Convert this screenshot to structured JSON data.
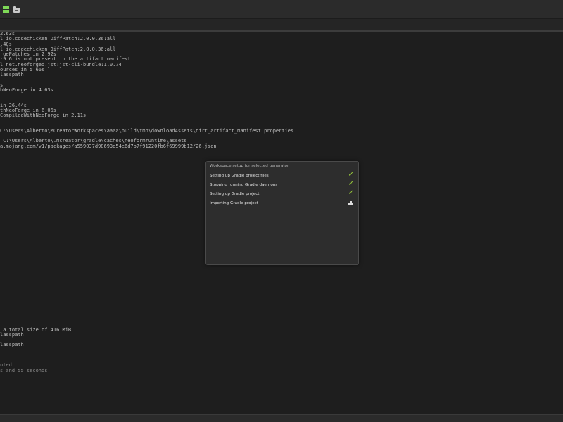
{
  "console": {
    "lines": [
      "2.63s",
      "l io.codechicken:DiffPatch:2.0.0.36:all",
      ".40s",
      "l io.codechicken:DiffPatch:2.0.0.36:all",
      "rgePatches in 2.92s",
      ":9.6 is not present in the artifact manifest",
      "l net.neoforged.jst:jst-cli-bundle:1.0.74",
      "ources in 5.66s",
      "lasspath",
      "",
      "s",
      "hNeoForge in 4.63s",
      "",
      "",
      "in 26.44s",
      "thNeoForge in 6.06s",
      "CompiledWithNeoForge in 2.11s",
      "",
      "",
      "C:\\Users\\Alberto\\MCreatorWorkspaces\\aaaa\\build\\tmp\\downloadAssets\\nfrt_artifact_manifest.properties",
      "",
      " C:\\Users\\Alberto\\.mcreator\\gradle\\caches\\neoformruntime\\assets",
      "a.mojang.com/v1/packages/a559037d98693d54e6d7b7f91220fb6f69999b12/26.json",
      "",
      "",
      "",
      "",
      "",
      "",
      "",
      "",
      "",
      "",
      "",
      "",
      "",
      "",
      "",
      "",
      "",
      "",
      "",
      "",
      "",
      "",
      "",
      "",
      "",
      "",
      "",
      "",
      "",
      "",
      "",
      "",
      "",
      "",
      "",
      " a total size of 416 MiB",
      "lasspath",
      "",
      "lasspath",
      "",
      "",
      "",
      "uted",
      "s and 55 seconds"
    ]
  },
  "dialog": {
    "title": "Workspace setup for selected generator",
    "steps": [
      {
        "label": "Setting up Gradle project files",
        "status": "done",
        "icon": "check-icon"
      },
      {
        "label": "Stopping running Gradle daemons",
        "status": "done",
        "icon": "check-icon"
      },
      {
        "label": "Setting up Gradle project",
        "status": "done",
        "icon": "check-icon"
      },
      {
        "label": "Importing Gradle project",
        "status": "in-progress",
        "icon": "working-icon"
      }
    ],
    "check_glyph": "✓"
  },
  "colors": {
    "background": "#1e1e1e",
    "accent_green": "#9ccf3c",
    "text": "#bdbdbd"
  }
}
